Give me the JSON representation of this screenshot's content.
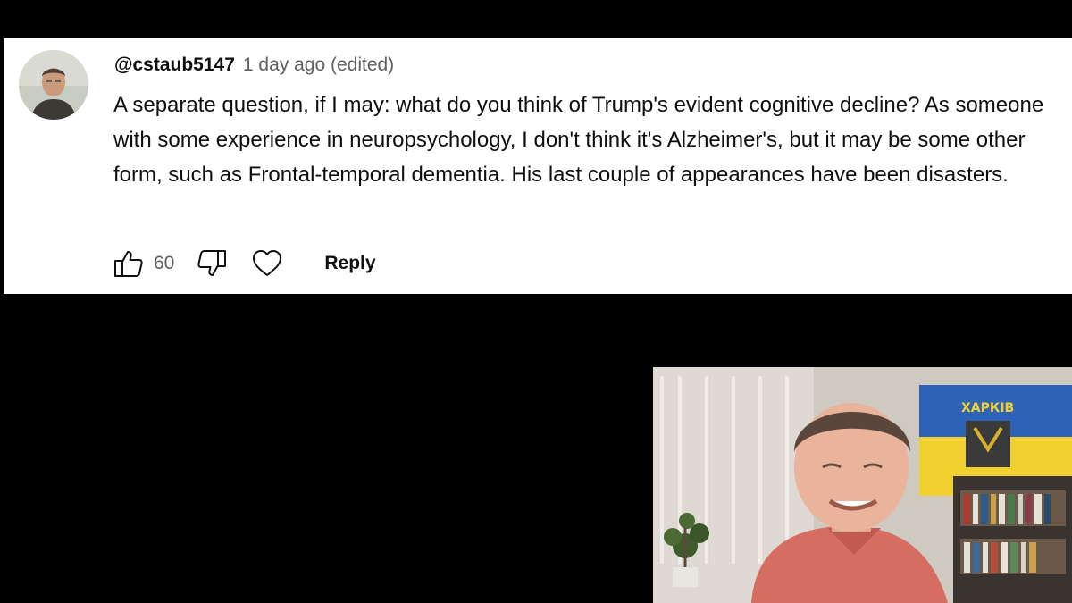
{
  "comment": {
    "username": "@cstaub5147",
    "timestamp": "1 day ago (edited)",
    "text": "A separate question, if I may: what do you think of Trump's evident cognitive decline? As someone with some experience in neuropsychology, I don't think it's Alzheimer's, but it may be some other form, such as Frontal-temporal dementia. His last couple of appearances have been disasters.",
    "like_count": "60",
    "reply_label": "Reply"
  },
  "icons": {
    "avatar": "user-avatar-photo",
    "like": "thumbs-up-icon",
    "dislike": "thumbs-down-icon",
    "heart": "heart-icon"
  },
  "webcam": {
    "flag_text": "ХАРКІВ",
    "flag_colors": {
      "top": "#2f63b7",
      "bottom": "#f1cf2e"
    }
  },
  "colors": {
    "background": "#000000",
    "card": "#ffffff",
    "text_primary": "#0f0f0f",
    "text_secondary": "#606060"
  }
}
